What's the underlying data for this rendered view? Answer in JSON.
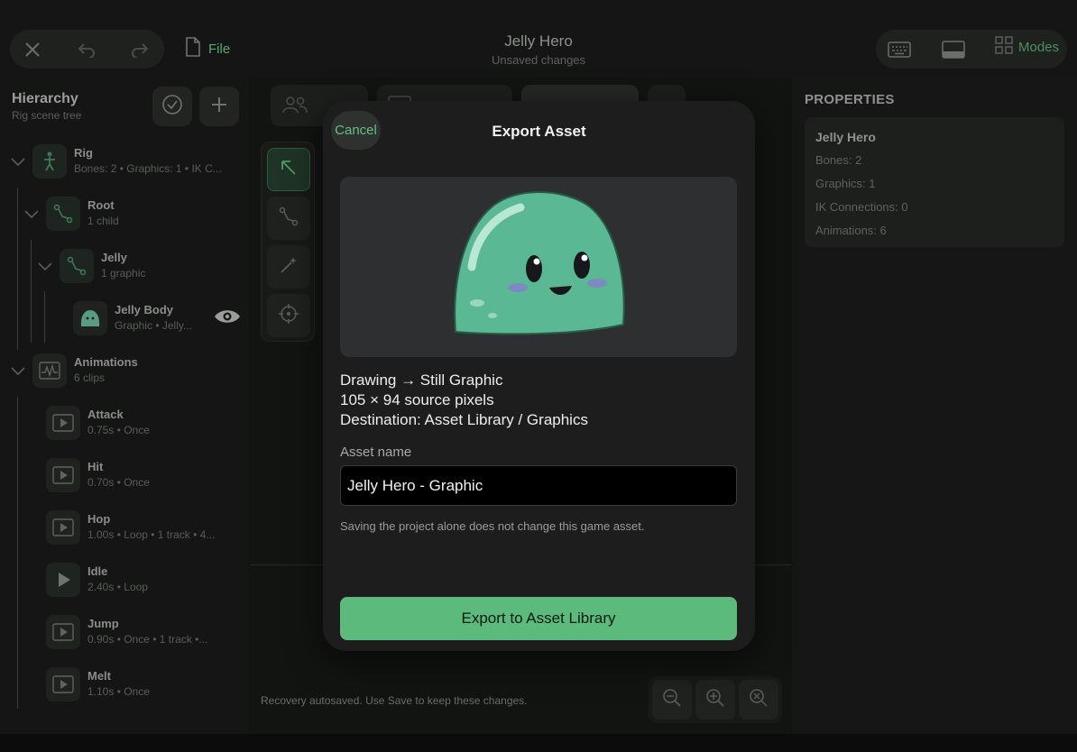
{
  "topbar": {
    "file_label": "File",
    "title": "Jelly Hero",
    "subtitle": "Unsaved changes",
    "modes_label": "Modes"
  },
  "hierarchy": {
    "title": "Hierarchy",
    "subtitle": "Rig scene tree",
    "nodes": [
      {
        "name": "Rig",
        "meta": "Bones: 2  •  Graphics: 1  •  IK C..."
      },
      {
        "name": "Root",
        "meta": "1 child"
      },
      {
        "name": "Jelly",
        "meta": "1 graphic"
      },
      {
        "name": "Jelly Body",
        "meta": "Graphic  •  Jelly..."
      },
      {
        "name": "Animations",
        "meta": "6 clips"
      }
    ],
    "clips": [
      {
        "name": "Attack",
        "meta": "0.75s  •  Once"
      },
      {
        "name": "Hit",
        "meta": "0.70s  •  Once"
      },
      {
        "name": "Hop",
        "meta": "1.00s  •  Loop  •  1 track  •  4..."
      },
      {
        "name": "Idle",
        "meta": "2.40s  •  Loop"
      },
      {
        "name": "Jump",
        "meta": "0.90s  •  Once  •  1 track  •..."
      },
      {
        "name": "Melt",
        "meta": "1.10s  •  Once"
      }
    ]
  },
  "canvas": {
    "recovery_text": "Recovery autosaved. Use Save to keep these changes."
  },
  "properties": {
    "title": "PROPERTIES",
    "name": "Jelly Hero",
    "lines": [
      "Bones: 2",
      "Graphics: 1",
      "IK Connections: 0",
      "Animations: 6"
    ]
  },
  "modal": {
    "title": "Export Asset",
    "cancel_label": "Cancel",
    "info_lines": [
      "Drawing → Still Graphic",
      "105 × 94 source pixels",
      "Destination: Asset Library / Graphics"
    ],
    "field_label": "Asset name",
    "asset_name": "Jelly Hero - Graphic",
    "hint": "Saving the project alone does not change this game asset.",
    "export_label": "Export to Asset Library"
  },
  "colors": {
    "accent": "#5cba7d",
    "jelly": "#5bb895",
    "background": "#101110"
  }
}
